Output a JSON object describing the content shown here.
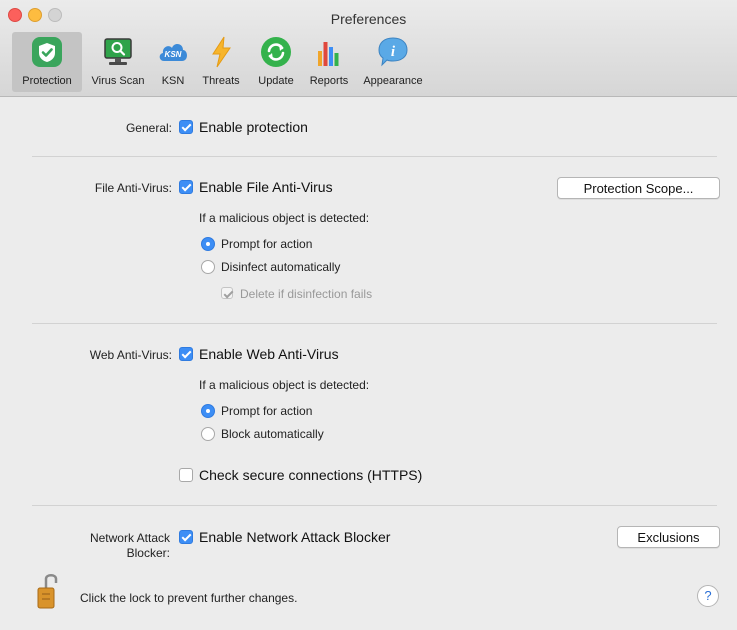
{
  "window": {
    "title": "Preferences"
  },
  "toolbar": {
    "items": [
      {
        "label": "Protection",
        "icon": "shield-icon",
        "active": true
      },
      {
        "label": "Virus Scan",
        "icon": "monitor-scan-icon"
      },
      {
        "label": "KSN",
        "icon": "cloud-ksn-icon",
        "badge": "KSN"
      },
      {
        "label": "Threats",
        "icon": "lightning-icon"
      },
      {
        "label": "Update",
        "icon": "refresh-icon"
      },
      {
        "label": "Reports",
        "icon": "bar-chart-icon"
      },
      {
        "label": "Appearance",
        "icon": "info-icon",
        "glyph": "i"
      }
    ]
  },
  "general": {
    "label": "General:",
    "enable_label": "Enable protection",
    "checked": true
  },
  "file_av": {
    "label": "File Anti-Virus:",
    "enable_label": "Enable File Anti-Virus",
    "checked": true,
    "scope_button": "Protection Scope...",
    "detected_text": "If a malicious object is detected:",
    "options": [
      "Prompt for action",
      "Disinfect automatically"
    ],
    "selected": "Prompt for action",
    "delete_label": "Delete if disinfection fails",
    "delete_checked": true,
    "delete_disabled": true
  },
  "web_av": {
    "label": "Web Anti-Virus:",
    "enable_label": "Enable Web Anti-Virus",
    "checked": true,
    "detected_text": "If a malicious object is detected:",
    "options": [
      "Prompt for action",
      "Block automatically"
    ],
    "selected": "Prompt for action",
    "https_label": "Check secure connections (HTTPS)",
    "https_checked": false
  },
  "network": {
    "label_line1": "Network Attack",
    "label_line2": "Blocker:",
    "enable_label": "Enable Network Attack Blocker",
    "checked": true,
    "exclusions_button": "Exclusions"
  },
  "footer": {
    "lock_text": "Click the lock to prevent further changes.",
    "help": "?",
    "lock_icon": "padlock-open-icon"
  },
  "colors": {
    "accent": "#3d8ef5",
    "shield": "#3aa55c",
    "lightning": "#f7b52c",
    "update": "#34b24c",
    "ksn": "#3c8ad8",
    "appearance": "#5aa9e6"
  }
}
